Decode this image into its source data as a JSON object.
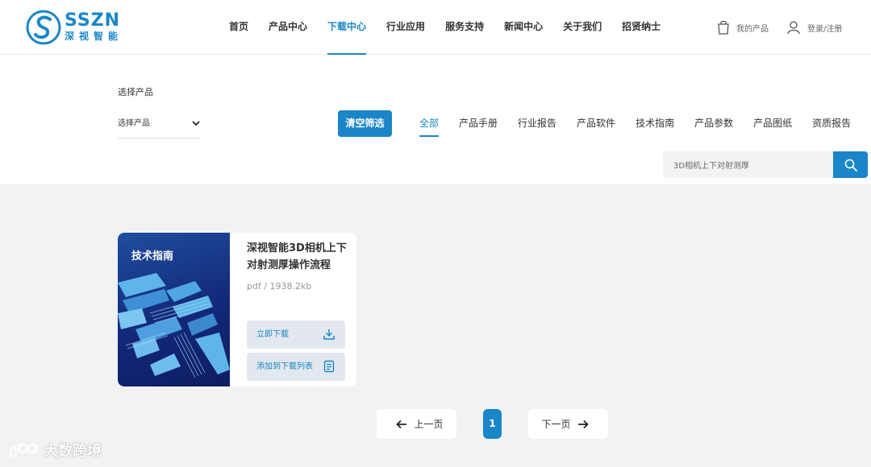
{
  "logo": {
    "en": "SSZN",
    "cn": "深视智能"
  },
  "nav": [
    {
      "label": "首页",
      "active": false
    },
    {
      "label": "产品中心",
      "active": false
    },
    {
      "label": "下载中心",
      "active": true
    },
    {
      "label": "行业应用",
      "active": false
    },
    {
      "label": "服务支持",
      "active": false
    },
    {
      "label": "新闻中心",
      "active": false
    },
    {
      "label": "关于我们",
      "active": false
    },
    {
      "label": "招贤纳士",
      "active": false
    }
  ],
  "header_right": {
    "my_products": "我的产品",
    "login": "登录/注册"
  },
  "filter": {
    "label": "选择产品",
    "select_value": "选择产品",
    "clear_button": "清空筛选",
    "tabs": [
      {
        "label": "全部",
        "active": true
      },
      {
        "label": "产品手册",
        "active": false
      },
      {
        "label": "行业报告",
        "active": false
      },
      {
        "label": "产品软件",
        "active": false
      },
      {
        "label": "技术指南",
        "active": false
      },
      {
        "label": "产品参数",
        "active": false
      },
      {
        "label": "产品图纸",
        "active": false
      },
      {
        "label": "资质报告",
        "active": false
      }
    ],
    "search_value": "3D相机上下对射测厚"
  },
  "card": {
    "cover_label": "技术指南",
    "title": "深视智能3D相机上下对射测厚操作流程",
    "meta": "pdf / 1938.2kb",
    "download_button": "立即下载",
    "add_button": "添加到下载列表"
  },
  "pagination": {
    "prev": "上一页",
    "current": "1",
    "next": "下一页"
  },
  "watermark": "大数跨境",
  "colors": {
    "brand": "#1a86c8",
    "background": "#f1f2f2"
  }
}
